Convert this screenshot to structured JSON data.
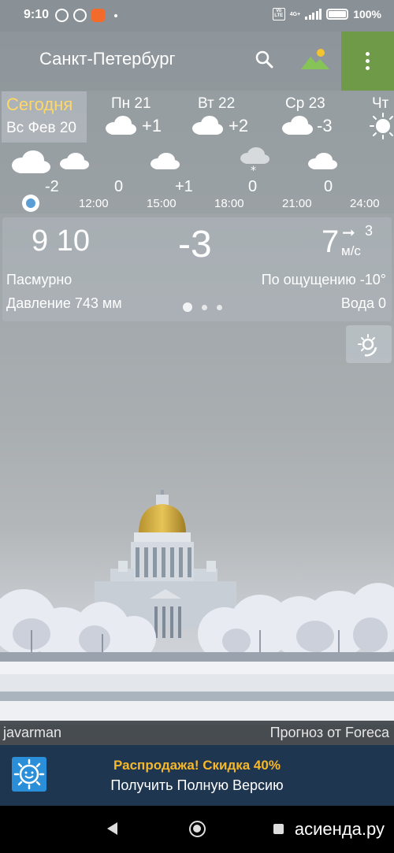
{
  "status": {
    "time": "9:10",
    "network": "4G+",
    "battery": "100%"
  },
  "header": {
    "city": "Санкт-Петербург",
    "search_icon": "search-icon",
    "landscape_icon": "landscape-icon",
    "menu_icon": "more-vert-icon",
    "menu_color": "#6f9a48"
  },
  "days": {
    "today_label": "Сегодня",
    "today_date": "Вс Фев 20",
    "items": [
      {
        "name": "Пн 21",
        "temp": "+1",
        "icon": "cloud-icon"
      },
      {
        "name": "Вт 22",
        "temp": "+2",
        "icon": "cloud-icon"
      },
      {
        "name": "Ср 23",
        "temp": "-3",
        "icon": "cloud-icon"
      },
      {
        "name": "Чт",
        "temp": "",
        "icon": "sun-icon"
      }
    ]
  },
  "hourly": {
    "temps": [
      "-2",
      "0",
      "+1",
      "0",
      "0"
    ],
    "times": [
      "12:00",
      "15:00",
      "18:00",
      "21:00",
      "24:00"
    ]
  },
  "current": {
    "time": "9 10",
    "temp": "-3",
    "wind_speed": "7",
    "wind_arrow": "➞",
    "wind_gust": "3",
    "wind_unit": "м/с",
    "description": "Пасмурно",
    "feels_like": "По ощущению -10°",
    "pressure": "Давление 743 мм",
    "water": "Вода 0",
    "page": 1,
    "pages": 3
  },
  "photo": {
    "author": "javarman",
    "forecast_source": "Прогноз от Foreca"
  },
  "promo": {
    "title": "Распродажа! Скидка 40%",
    "subtitle": "Получить Полную Версию",
    "title_color": "#f6b829",
    "bg_color": "#1f3650"
  },
  "watermark": "асиенда.ру"
}
